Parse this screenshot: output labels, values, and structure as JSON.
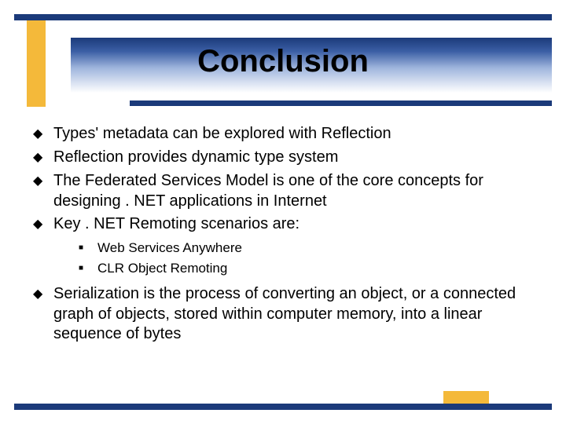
{
  "title": "Conclusion",
  "bullets": [
    {
      "text": "Types' metadata can be explored with Reflection"
    },
    {
      "text": "Reflection provides dynamic type system"
    },
    {
      "text": "The Federated Services Model is one of the core concepts for designing . NET applications in Internet"
    },
    {
      "text": "Key . NET Remoting scenarios are:",
      "sub": [
        "Web Services Anywhere",
        "CLR Object Remoting"
      ]
    },
    {
      "text": "Serialization is the process of converting an object, or a connected graph of objects, stored within computer memory, into a linear sequence of bytes"
    }
  ],
  "colors": {
    "bar": "#1b3a7a",
    "accent": "#f4b93a"
  }
}
